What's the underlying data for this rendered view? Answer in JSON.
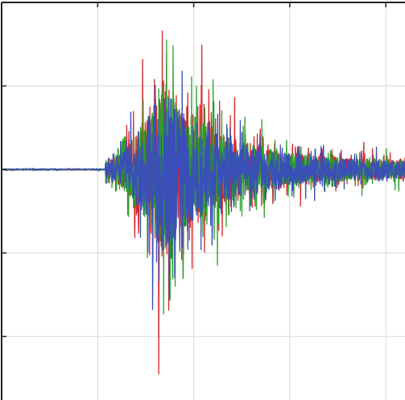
{
  "chart_data": {
    "type": "line",
    "title": "",
    "xlabel": "",
    "ylabel": "",
    "grid": true,
    "legend": "none",
    "xlim": [
      0,
      4.2
    ],
    "ylim": [
      -1.38,
      1.0
    ],
    "x_gridlines": [
      1,
      2,
      3,
      4
    ],
    "y_gridlines": [
      -1.0,
      -0.5,
      0.5
    ],
    "signal": {
      "onset_x": 1.08,
      "peak_x": 1.68,
      "max_amplitude": 1.3,
      "pre_onset_noise": 0.008,
      "residual_amplitude_at_end": 0.12,
      "samples": 1500
    },
    "series": [
      {
        "color": "#d62728",
        "seed": 11,
        "amplitude_scale": 1.05
      },
      {
        "color": "#2ca02c",
        "seed": 23,
        "amplitude_scale": 1.0
      },
      {
        "color": "#3a4fb8",
        "seed": 37,
        "amplitude_scale": 0.95
      }
    ],
    "colors": {
      "background": "#ffffff",
      "grid": "#d9d9d9",
      "axis": "#202020"
    }
  }
}
